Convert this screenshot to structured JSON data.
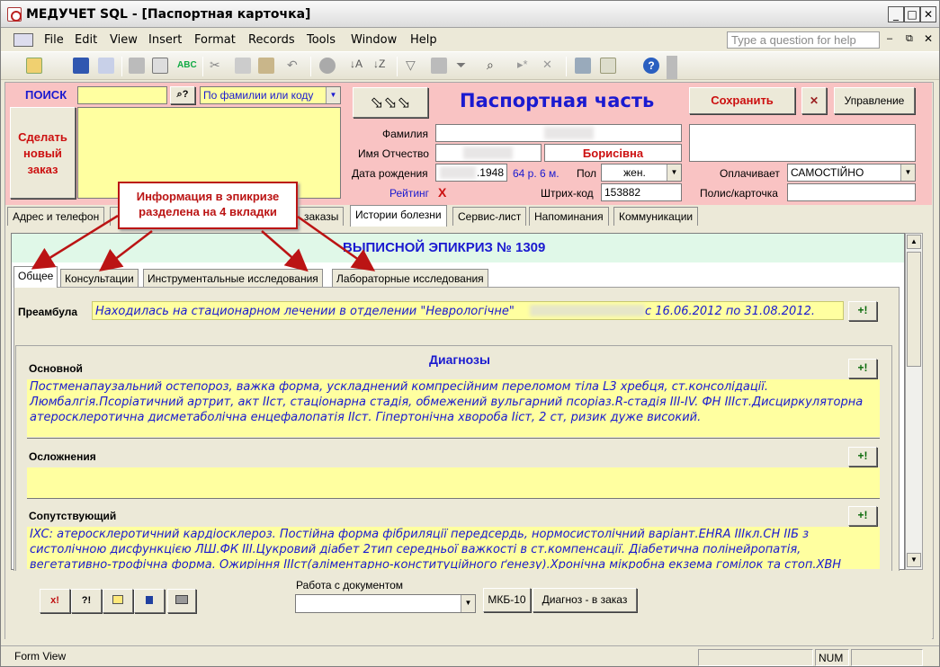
{
  "window": {
    "title": "МЕДУЧЕТ SQL - [Паспортная карточка]"
  },
  "menu": [
    "File",
    "Edit",
    "View",
    "Insert",
    "Format",
    "Records",
    "Tools",
    "Window",
    "Help"
  ],
  "help_placeholder": "Type a question for help",
  "search": {
    "label": "ПОИСК",
    "value": "",
    "mode": "По фамилии или коду"
  },
  "new_order_button": "Сделать новый заказ",
  "passport": {
    "title": "Паспортная часть",
    "save_label": "Сохранить",
    "manage_label": "Управление",
    "surname_label": "Фамилия",
    "name_label": "Имя Отчество",
    "patronymic": "Борисівна",
    "dob_label": "Дата рождения",
    "dob_value": ".1948",
    "age": "64 р. 6 м.",
    "sex_label": "Пол",
    "sex_value": "жен.",
    "rating_label": "Рейтинг",
    "rating_value": "X",
    "barcode_label": "Штрих-код",
    "barcode_value": "153882",
    "payer_label": "Оплачивает",
    "payer_value": "САМОСТІЙНО",
    "policy_label": "Полис/карточка",
    "policy_value": ""
  },
  "main_tabs": [
    "Адрес и телефон",
    "",
    "заказы",
    "Истории болезни",
    "Сервис-лист",
    "Напоминания",
    "Коммуникации"
  ],
  "callout": "Информация в эпикризе разделена на 4 вкладки",
  "epicrisis": {
    "title": "ВЫПИСНОЙ ЭПИКРИЗ № 1309",
    "tabs": [
      "Общее",
      "Консультации",
      "Инструментальные исследования",
      "Лабораторные исследования"
    ],
    "preamble_label": "Преамбула",
    "preamble_text_a": "Находилась на стационарном лечении в отделении \"Неврологічне\"",
    "preamble_text_b": "с 16.06.2012 по 31.08.2012.",
    "diagnoses_title": "Диагнозы",
    "main_label": "Основной",
    "main_text": "Постменапаузальний остепороз, важка форма, ускладнений компресійним переломом тіла L3 хребця, ст.консолідації. Люмбалгія.Псоріатичний артрит, акт IIст, стаціонарна стадія, обмежений вульгарний псоріаз.R-стадія III-IV. ФН IIIст.Дисциркуляторна атеросклеротична дисметаболічна енцефалопатія IIст. Гіпертонічна хвороба Iicт, 2 ст, ризик дуже високий.",
    "complications_label": "Осложнения",
    "complications_text": "",
    "concomitant_label": "Сопутствующий",
    "concomitant_text": "IXC: атеросклеротичний кардіосклероз. Постійна форма фібриляції передсердь, нормосистолічний варіант.EHRA IIIкл.СН IIБ з систолічною дисфункцією ЛШ.ФК III.Цукровий діабет 2тип середньої важкості в ст.компенсації. Діабетична полінейропатія, вегетативно-трофічна форма. Ожиріння IIIст(аліментарно-конституційного ґенезу).Хронічна мікробна екзема гомілок та стоп.ХВН",
    "plus_label": "+!"
  },
  "bottom": {
    "doc_label": "Работа с документом",
    "doc_value": "",
    "mkb_label": "МКБ-10",
    "diag_label": "Диагноз - в заказ",
    "btn1": "x!",
    "btn2": "?!"
  },
  "status": {
    "left": "Form View",
    "num": "NUM"
  }
}
